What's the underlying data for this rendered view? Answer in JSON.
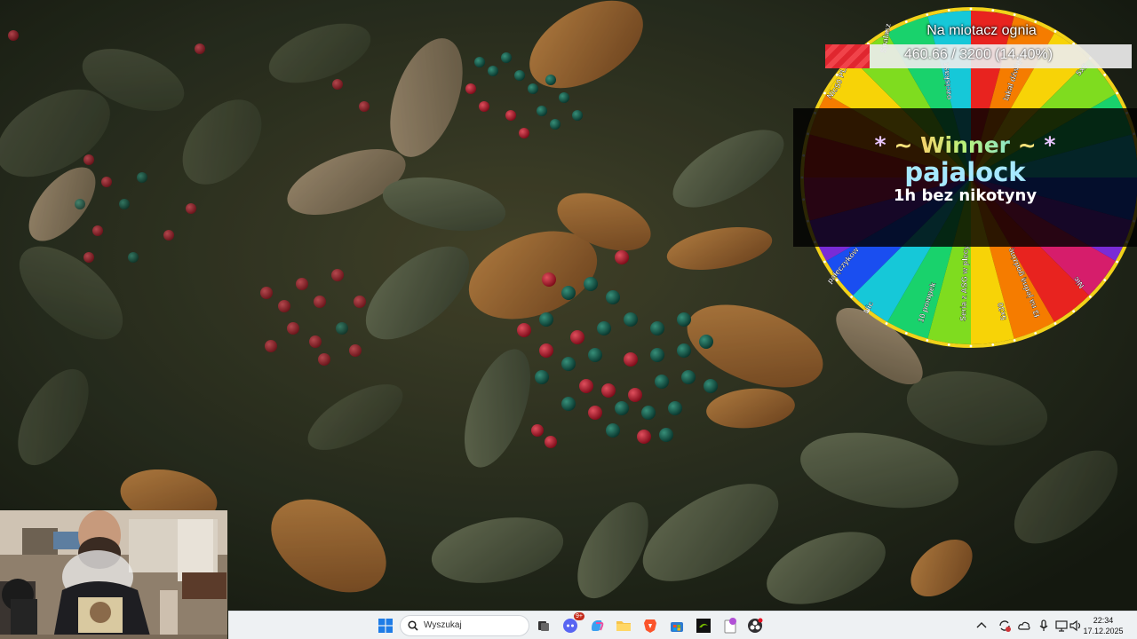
{
  "goal": {
    "title": "Na miotacz ognia",
    "progress_text": "460.66 / 3200 (14.40%)",
    "current": 460.66,
    "target": 3200,
    "percent": 14.4,
    "fill_color": "#e0262f"
  },
  "wheel": {
    "segments_top": [
      "Nic",
      "Spalasz",
      "ozciskasz",
      "lakal dźwięki",
      "5x5"
    ],
    "segments_left": [
      "50 PLN",
      "Nic"
    ],
    "segments_bottom": [
      "Nic",
      "10 pompek",
      "Seria z ASG w plecy",
      "5x30",
      "f3 na jedną godzinę",
      "Nic",
      "pałęczyków"
    ],
    "winner_heading_star": "*",
    "winner_heading_tilde": "~",
    "winner_heading_word": "Winner",
    "winner_name": "pajalock",
    "winner_prize": "1h bez nikotyny",
    "colors": [
      "#e8231f",
      "#f57c00",
      "#f7d307",
      "#7fdc1f",
      "#19d26c",
      "#16c8d8",
      "#1a4ef0",
      "#7a2bd6",
      "#d61d6b"
    ]
  },
  "taskbar": {
    "search_placeholder": "Wyszukaj",
    "discord_badge": "9+",
    "time": "22:34",
    "date": "17.12.2025"
  },
  "icons": {
    "start": "windows-start-icon",
    "search": "search-icon",
    "task_view": "task-view-icon",
    "discord": "discord-icon",
    "copilot": "copilot-icon",
    "explorer": "folder-icon",
    "brave": "brave-browser-icon",
    "store": "microsoft-store-icon",
    "nvidia": "nvidia-icon",
    "notes": "notes-icon",
    "obs": "obs-icon"
  }
}
